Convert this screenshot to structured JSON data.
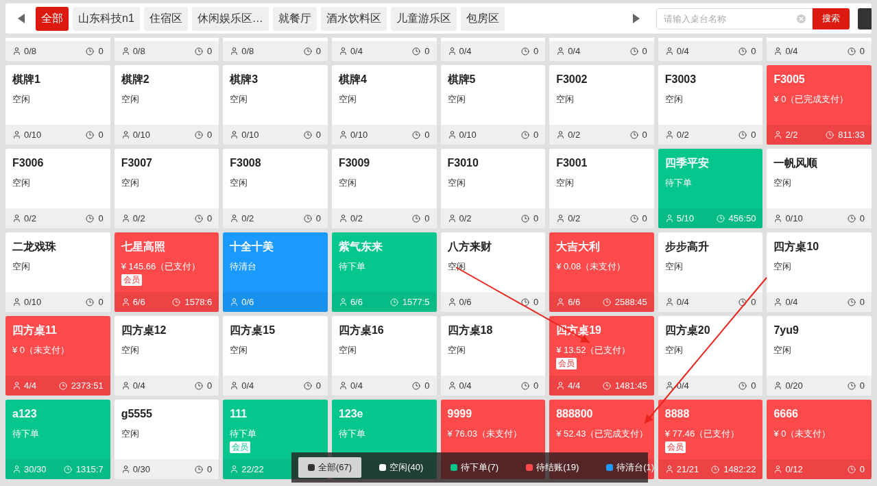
{
  "tabs": [
    {
      "label": "全部",
      "selected": true
    },
    {
      "label": "山东科技n1",
      "selected": false
    },
    {
      "label": "住宿区",
      "selected": false
    },
    {
      "label": "休闲娱乐区…",
      "selected": false
    },
    {
      "label": "就餐厅",
      "selected": false
    },
    {
      "label": "酒水饮料区",
      "selected": false
    },
    {
      "label": "儿童游乐区",
      "selected": false
    },
    {
      "label": "包房区",
      "selected": false
    }
  ],
  "search": {
    "placeholder": "请输入桌台名称",
    "button": "搜索"
  },
  "partial_row": [
    {
      "guests": "0/8",
      "time": "0"
    },
    {
      "guests": "0/8",
      "time": "0"
    },
    {
      "guests": "0/8",
      "time": "0"
    },
    {
      "guests": "0/4",
      "time": "0"
    },
    {
      "guests": "0/4",
      "time": "0"
    },
    {
      "guests": "0/4",
      "time": "0"
    },
    {
      "guests": "0/4",
      "time": "0"
    },
    {
      "guests": "0/4",
      "time": "0"
    }
  ],
  "tables": [
    {
      "name": "棋牌1",
      "kind": "idle",
      "status": "空闲",
      "guests": "0/10",
      "time": "0"
    },
    {
      "name": "棋牌2",
      "kind": "idle",
      "status": "空闲",
      "guests": "0/10",
      "time": "0"
    },
    {
      "name": "棋牌3",
      "kind": "idle",
      "status": "空闲",
      "guests": "0/10",
      "time": "0"
    },
    {
      "name": "棋牌4",
      "kind": "idle",
      "status": "空闲",
      "guests": "0/10",
      "time": "0"
    },
    {
      "name": "棋牌5",
      "kind": "idle",
      "status": "空闲",
      "guests": "0/10",
      "time": "0"
    },
    {
      "name": "F3002",
      "kind": "idle",
      "status": "空闲",
      "guests": "0/2",
      "time": "0"
    },
    {
      "name": "F3003",
      "kind": "idle",
      "status": "空闲",
      "guests": "0/2",
      "time": "0"
    },
    {
      "name": "F3005",
      "kind": "checkout",
      "status": "¥ 0（已完成支付）",
      "guests": "2/2",
      "time": "811:33"
    },
    {
      "name": "F3006",
      "kind": "idle",
      "status": "空闲",
      "guests": "0/2",
      "time": "0"
    },
    {
      "name": "F3007",
      "kind": "idle",
      "status": "空闲",
      "guests": "0/2",
      "time": "0"
    },
    {
      "name": "F3008",
      "kind": "idle",
      "status": "空闲",
      "guests": "0/2",
      "time": "0"
    },
    {
      "name": "F3009",
      "kind": "idle",
      "status": "空闲",
      "guests": "0/2",
      "time": "0"
    },
    {
      "name": "F3010",
      "kind": "idle",
      "status": "空闲",
      "guests": "0/2",
      "time": "0"
    },
    {
      "name": "F3001",
      "kind": "idle",
      "status": "空闲",
      "guests": "0/2",
      "time": "0"
    },
    {
      "name": "四季平安",
      "kind": "order",
      "status": "待下单",
      "guests": "5/10",
      "time": "456:50"
    },
    {
      "name": "一帆风顺",
      "kind": "idle",
      "status": "空闲",
      "guests": "0/10",
      "time": "0"
    },
    {
      "name": "二龙戏珠",
      "kind": "idle",
      "status": "空闲",
      "guests": "0/10",
      "time": "0"
    },
    {
      "name": "七星高照",
      "kind": "checkout",
      "status": "¥ 145.66（已支付）",
      "badge": "会员",
      "guests": "6/6",
      "time": "1578:6"
    },
    {
      "name": "十全十美",
      "kind": "clean",
      "status": "待清台",
      "guests": "0/6"
    },
    {
      "name": "紫气东来",
      "kind": "order",
      "status": "待下单",
      "guests": "6/6",
      "time": "1577:5"
    },
    {
      "name": "八方来财",
      "kind": "idle",
      "status": "空闲",
      "guests": "0/6",
      "time": "0"
    },
    {
      "name": "大吉大利",
      "kind": "checkout",
      "status": "¥ 0.08（未支付）",
      "guests": "6/6",
      "time": "2588:45"
    },
    {
      "name": "步步高升",
      "kind": "idle",
      "status": "空闲",
      "guests": "0/4",
      "time": "0"
    },
    {
      "name": "四方桌10",
      "kind": "idle",
      "status": "空闲",
      "guests": "0/4",
      "time": "0"
    },
    {
      "name": "四方桌11",
      "kind": "checkout",
      "status": "¥ 0（未支付）",
      "guests": "4/4",
      "time": "2373:51"
    },
    {
      "name": "四方桌12",
      "kind": "idle",
      "status": "空闲",
      "guests": "0/4",
      "time": "0"
    },
    {
      "name": "四方桌15",
      "kind": "idle",
      "status": "空闲",
      "guests": "0/4",
      "time": "0"
    },
    {
      "name": "四方桌16",
      "kind": "idle",
      "status": "空闲",
      "guests": "0/4",
      "time": "0"
    },
    {
      "name": "四方桌18",
      "kind": "idle",
      "status": "空闲",
      "guests": "0/4",
      "time": "0"
    },
    {
      "name": "四方桌19",
      "kind": "checkout",
      "status": "¥ 13.52（已支付）",
      "badge": "会员",
      "guests": "4/4",
      "time": "1481:45"
    },
    {
      "name": "四方桌20",
      "kind": "idle",
      "status": "空闲",
      "guests": "0/4",
      "time": "0"
    },
    {
      "name": "7yu9",
      "kind": "idle",
      "status": "空闲",
      "guests": "0/20",
      "time": "0"
    },
    {
      "name": "a123",
      "kind": "order",
      "status": "待下单",
      "guests": "30/30",
      "time": "1315:7"
    },
    {
      "name": "g5555",
      "kind": "idle",
      "status": "空闲",
      "guests": "0/30",
      "time": "0"
    },
    {
      "name": "111",
      "kind": "order",
      "status": "待下单",
      "badge": "会员",
      "guests": "22/22"
    },
    {
      "name": "123e",
      "kind": "order",
      "status": "待下单"
    },
    {
      "name": "9999",
      "kind": "checkout",
      "status": "¥ 76.03（未支付）"
    },
    {
      "name": "888800",
      "kind": "checkout",
      "status": "¥ 52.43（已完成支付）"
    },
    {
      "name": "8888",
      "kind": "checkout",
      "status": "¥ 77.46（已支付）",
      "badge": "会员",
      "guests": "21/21",
      "time": "1482:22"
    },
    {
      "name": "6666",
      "kind": "checkout",
      "status": "¥ 0（未支付）",
      "guests": "0/12",
      "time": "0"
    }
  ],
  "legend": [
    {
      "label": "全部(67)",
      "color": "#333333",
      "selected": true
    },
    {
      "label": "空闲(40)",
      "color": "#ffffff",
      "selected": false
    },
    {
      "label": "待下单(7)",
      "color": "#05c68d",
      "selected": false
    },
    {
      "label": "待结账(19)",
      "color": "#fe4a4b",
      "selected": false
    },
    {
      "label": "待清台(1)",
      "color": "#1a9afe",
      "selected": false
    }
  ]
}
